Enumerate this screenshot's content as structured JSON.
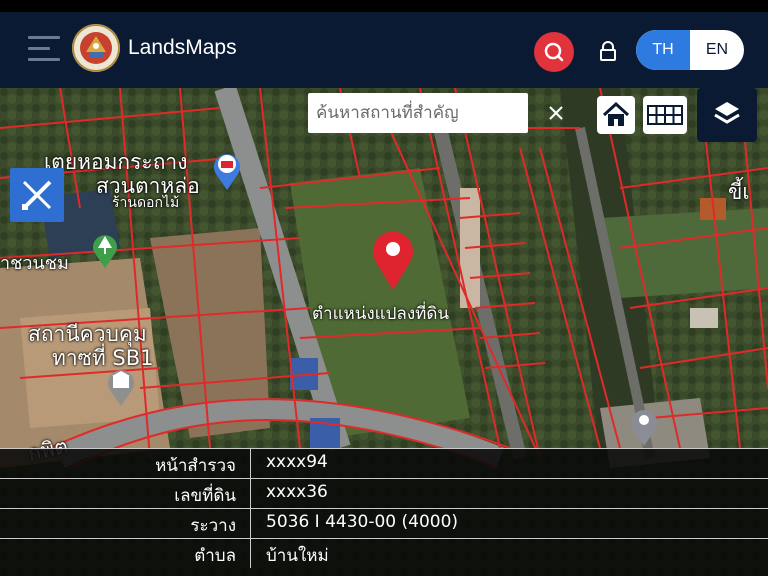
{
  "header": {
    "brand": "LandsMaps",
    "lang_th": "TH",
    "lang_en": "EN",
    "active_lang": "TH"
  },
  "map": {
    "search_placeholder": "ค้นหาสถานที่สำคัญ",
    "labels": {
      "market_top": "เตยหอมกระถาง",
      "garden": "สวนตาหล่อ",
      "flower_shop": "ร้านดอกไม้",
      "left_edge": "าชวนชม",
      "station_1": "สถานีควบคุม",
      "station_2": "ทาซที่ SB1",
      "road": "กพิต",
      "right_edge": "ขี้เ",
      "parcel_location": "ตำแหน่งแปลงที่ดิน"
    },
    "icons": {
      "home": "home-icon",
      "grid": "grid-icon",
      "layers": "layers-icon",
      "measure": "measure-icon",
      "search": "search-icon",
      "lock": "lock-icon",
      "close": "close-icon"
    },
    "colors": {
      "parcel_lines": "#e02a2a",
      "pin": "#e0242f",
      "header_bg": "#0b1a33",
      "accent_blue": "#2d7be0",
      "search_red": "#e0333c"
    }
  },
  "info": {
    "rows": [
      {
        "label": "หน้าสำรวจ",
        "value": "xxxx94"
      },
      {
        "label": "เลขที่ดิน",
        "value": "xxxx36"
      },
      {
        "label": "ระวาง",
        "value": "5036 I 4430-00 (4000)"
      },
      {
        "label": "ตำบล",
        "value": "บ้านใหม่"
      }
    ]
  }
}
